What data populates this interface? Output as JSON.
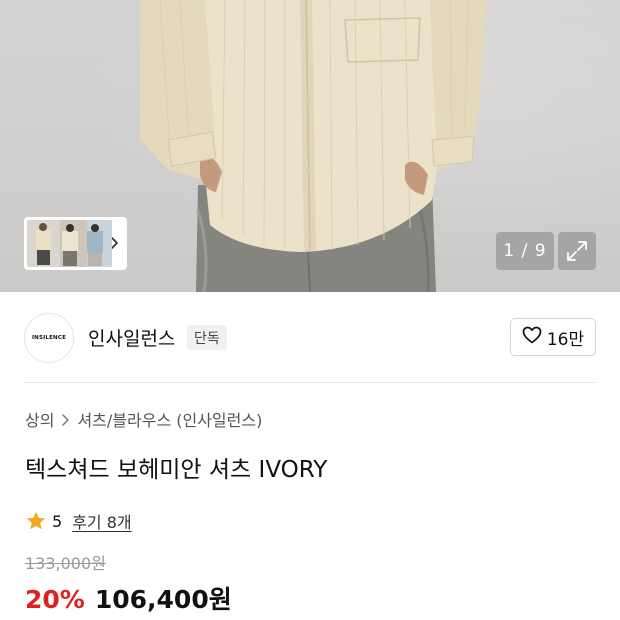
{
  "gallery": {
    "counter": "1 / 9",
    "expand_icon": "expand-icon",
    "thumbnail_next_icon": "chevron-right-icon"
  },
  "brand": {
    "logo_text": "INSILENCE",
    "name": "인사일런스",
    "tag": "단독",
    "like_icon": "heart-outline-icon",
    "like_count": "16만"
  },
  "breadcrumb": {
    "items": [
      "상의",
      "셔츠/블라우스 (인사일런스)"
    ]
  },
  "product": {
    "title": "텍스쳐드 보헤미안 셔츠 IVORY",
    "rating": "5",
    "rating_icon": "star-icon",
    "review_link": "후기 8개",
    "original_price": "133,000원",
    "discount": "20%",
    "sale_price": "106,400원"
  },
  "colors": {
    "discount": "#e02020",
    "star": "#f5a623"
  }
}
